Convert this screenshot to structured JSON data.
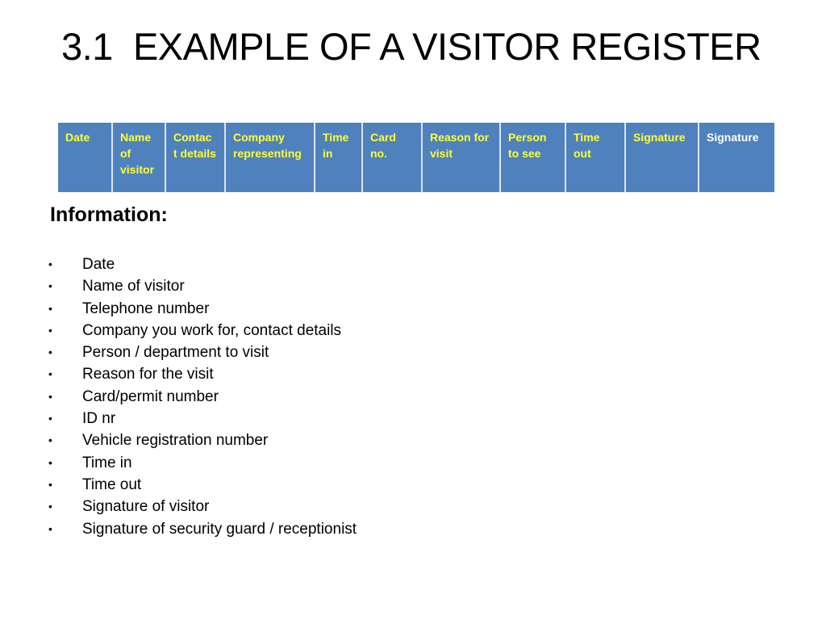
{
  "slide": {
    "title": "3.1  EXAMPLE OF A VISITOR REGISTER",
    "register_table": {
      "header_color": "#4f81bd",
      "text_color": "#ffff33",
      "columns": [
        {
          "label": "Date"
        },
        {
          "label": "Name of visitor"
        },
        {
          "label": "Contac t details"
        },
        {
          "label": "Company representing"
        },
        {
          "label": "Time in"
        },
        {
          "label": "Card no."
        },
        {
          "label": "Reason for visit"
        },
        {
          "label": "Person to see"
        },
        {
          "label": "Time out"
        },
        {
          "label": "Signature"
        },
        {
          "label": "Signature"
        }
      ]
    },
    "info_heading": "Information:",
    "info_items": [
      "Date",
      "Name of visitor",
      "Telephone number",
      "Company you work for, contact details",
      "Person / department to visit",
      "Reason for the visit",
      "Card/permit number",
      "ID nr",
      "Vehicle registration number",
      "Time in",
      "Time out",
      "Signature of visitor",
      "Signature of security guard / receptionist"
    ],
    "bullet_glyph": "•"
  }
}
